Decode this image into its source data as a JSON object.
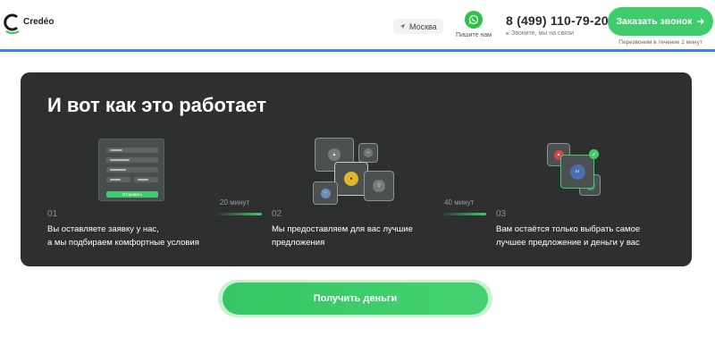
{
  "header": {
    "logo_text": "Credéo",
    "city": "Москва",
    "whatsapp_label": "Пишите нам",
    "phone": "8 (499) 110-79-20",
    "phone_sub": "Звоните, мы на связи",
    "callback_label": "Заказать звонок",
    "callback_note": "Перезвоним в течение 2 минут"
  },
  "section": {
    "title": "И вот как это работает",
    "steps": [
      {
        "num": "01",
        "line1": "Вы оставляете заявку у нас,",
        "line2": "а мы подбираем комфортные условия"
      },
      {
        "num": "02",
        "line1": "Мы предоставляем для вас лучшие",
        "line2": "предложения"
      },
      {
        "num": "03",
        "line1": "Вам остаётся только выбрать самое",
        "line2": "лучшее предложение и деньги у вас"
      }
    ],
    "durations": [
      "20 минут",
      "40 минут"
    ],
    "form_button": "Отправить"
  },
  "cta": {
    "label": "Получить деньги"
  },
  "colors": {
    "accent": "#3fcc6a",
    "card_bg": "#2e3030",
    "header_line": "#3a82f0"
  },
  "icons": [
    "location-icon",
    "whatsapp-icon",
    "arrow-right-icon",
    "check-icon"
  ]
}
